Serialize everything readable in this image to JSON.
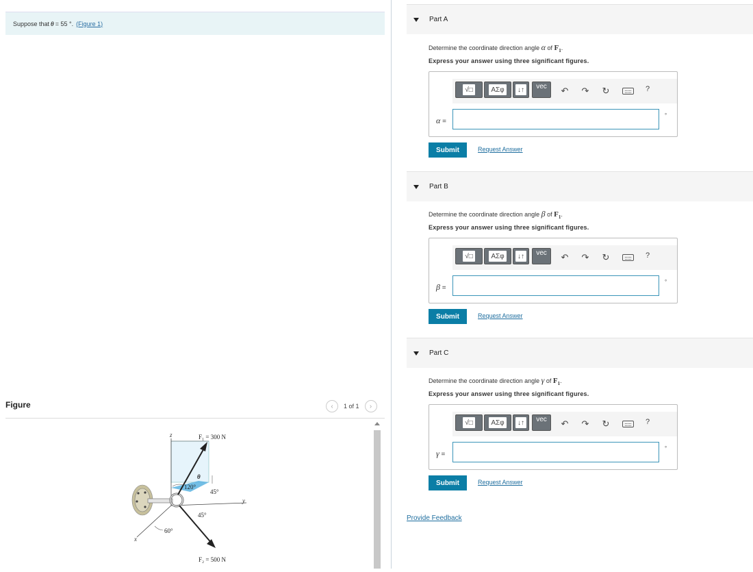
{
  "problem": {
    "prefix": "Suppose that",
    "symbol": "θ",
    "value": "= 55 °.",
    "figure_link": "(Figure 1)"
  },
  "figure": {
    "heading": "Figure",
    "pager": "1 of 1",
    "prev_icon": "chevron-left-icon",
    "next_icon": "chevron-right-icon",
    "labels": {
      "z": "z",
      "y": "y",
      "x": "x",
      "f1": "F₁ = 300 N",
      "f2": "F₂ = 500 N",
      "theta": "θ",
      "a120": "120°",
      "a45a": "45°",
      "a45b": "45°",
      "a60": "60°"
    },
    "colors": {
      "plane": "#cfe9f7",
      "shade": "#5ab3e0"
    }
  },
  "toolbar": {
    "template_label": "√□",
    "greek_label": "ΑΣφ",
    "arrows_label": "↓↑",
    "vec_label": "vec",
    "undo_icon": "undo-icon",
    "redo_icon": "redo-icon",
    "reset_icon": "reset-icon",
    "keyboard_icon": "keyboard-icon",
    "help_label": "?"
  },
  "parts": [
    {
      "header": "Part A",
      "prompt_text": "Determine the coordinate direction angle",
      "symbol": "α",
      "of_text": "of",
      "force": "F",
      "force_sub": "1",
      "instruction": "Express your answer using three significant figures.",
      "answer_label": "α",
      "answer_value": "",
      "unit": "°",
      "submit": "Submit",
      "request": "Request Answer"
    },
    {
      "header": "Part B",
      "prompt_text": "Determine the coordinate direction angle",
      "symbol": "β",
      "of_text": "of",
      "force": "F",
      "force_sub": "1",
      "instruction": "Express your answer using three significant figures.",
      "answer_label": "β",
      "answer_value": "",
      "unit": "°",
      "submit": "Submit",
      "request": "Request Answer"
    },
    {
      "header": "Part C",
      "prompt_text": "Determine the coordinate direction angle",
      "symbol": "γ",
      "of_text": "of",
      "force": "F",
      "force_sub": "1",
      "instruction": "Express your answer using three significant figures.",
      "answer_label": "γ",
      "answer_value": "",
      "unit": "°",
      "submit": "Submit",
      "request": "Request Answer"
    }
  ],
  "feedback": "Provide Feedback"
}
